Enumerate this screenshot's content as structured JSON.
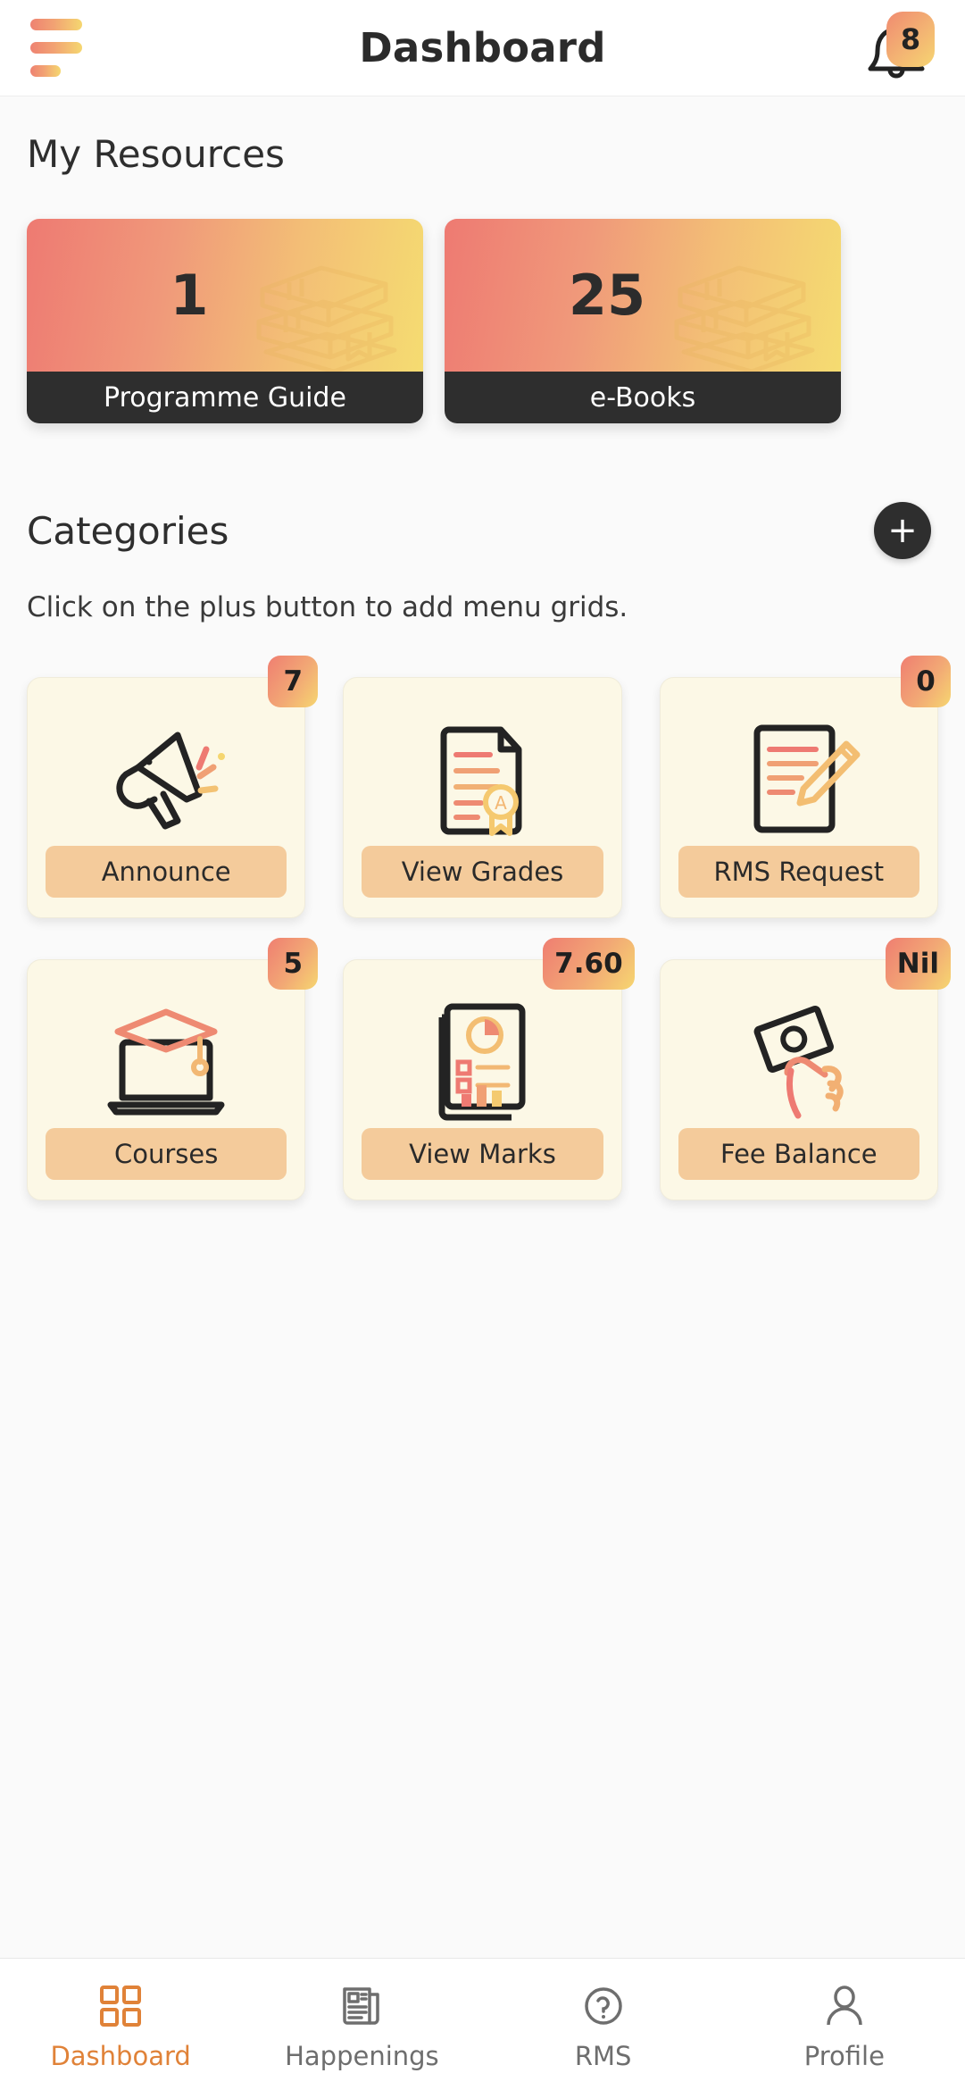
{
  "header": {
    "menu_icon": "hamburger-icon",
    "title": "Dashboard",
    "bell_icon": "bell-icon",
    "notification_count": "8"
  },
  "resources": {
    "title": "My Resources",
    "cards": [
      {
        "count": "1",
        "label": "Programme Guide",
        "icon": "books-stack-icon"
      },
      {
        "count": "25",
        "label": "e-Books",
        "icon": "books-stack-icon"
      }
    ]
  },
  "categories": {
    "title": "Categories",
    "add_label": "+",
    "subtitle": "Click on the plus button to add menu grids.",
    "tiles": [
      {
        "label": "Announce",
        "badge": "7",
        "icon": "megaphone-icon"
      },
      {
        "label": "View Grades",
        "badge": "",
        "icon": "document-award-icon"
      },
      {
        "label": "RMS Request",
        "badge": "0",
        "icon": "document-pencil-icon"
      },
      {
        "label": "Courses",
        "badge": "5",
        "icon": "laptop-graduation-icon"
      },
      {
        "label": "View Marks",
        "badge": "7.60",
        "icon": "report-chart-icon"
      },
      {
        "label": "Fee Balance",
        "badge": "Nil",
        "icon": "hand-money-icon"
      }
    ]
  },
  "bottom_nav": {
    "items": [
      {
        "label": "Dashboard",
        "icon": "grid-icon",
        "active": true
      },
      {
        "label": "Happenings",
        "icon": "news-icon",
        "active": false
      },
      {
        "label": "RMS",
        "icon": "question-icon",
        "active": false
      },
      {
        "label": "Profile",
        "icon": "user-icon",
        "active": false
      }
    ]
  },
  "colors": {
    "gradient_start": "#EE7A72",
    "gradient_end": "#F5DC71",
    "tile_bg": "#FCF8E6",
    "pill_bg": "#F4CB9B",
    "dark": "#2E2E2E",
    "accent": "#E08238"
  }
}
